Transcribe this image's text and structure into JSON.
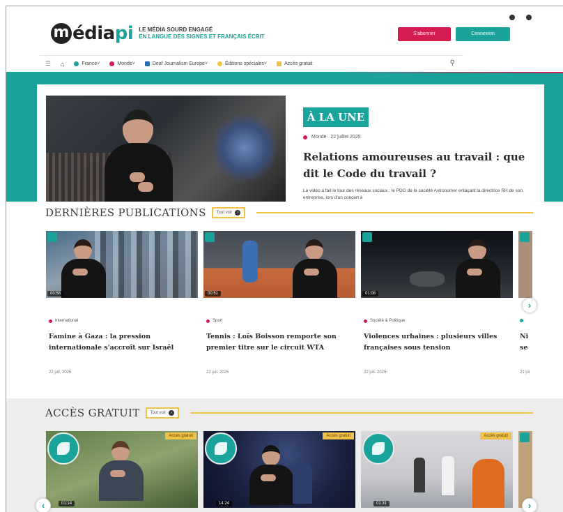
{
  "header": {
    "logo_m": "m",
    "logo_word": "édia",
    "logo_pi": "pi",
    "tagline_1": "Le média sourd engagé",
    "tagline_2": "En langue des signes et français écrit",
    "subscribe_label": "S'abonner",
    "login_label": "Connexion"
  },
  "nav": {
    "items": [
      {
        "label": "France",
        "color": "#1aa39a"
      },
      {
        "label": "Monde",
        "color": "#d51c52"
      },
      {
        "label": "Deaf Journalism Europe",
        "color": "#2a6fb5"
      },
      {
        "label": "Éditions spéciales",
        "color": "#f0c24a"
      },
      {
        "label": "Accès gratuit",
        "color": "#f0c24a"
      }
    ]
  },
  "hero": {
    "badge": "À LA UNE",
    "category": "Monde",
    "date": "22 juillet 2025",
    "title": "Relations amoureuses au travail : que dit le Code du travail ?",
    "excerpt": "La vidéo a fait le tour des réseaux sociaux : le PDG de la société Astronomer enlaçant la directrice RH de son entreprise, lors d'un concert à"
  },
  "latest": {
    "title": "DERNIÈRES PUBLICATIONS",
    "see_all": "Tout voir",
    "cards": [
      {
        "duration": "00:58",
        "category": "International",
        "cat_color": "#d51c52",
        "title": "Famine à Gaza : la pression internationale s'accroît sur Israël",
        "date": "22 juil. 2025"
      },
      {
        "duration": "00:51",
        "category": "Sport",
        "cat_color": "#d51c52",
        "title": "Tennis : Loïs Boisson remporte son premier titre sur le circuit WTA",
        "date": "22 juil. 2025"
      },
      {
        "duration": "01:08",
        "category": "Société & Politique",
        "cat_color": "#d51c52",
        "title": "Violences urbaines : plusieurs villes françaises sous tension",
        "date": "22 juil. 2025"
      }
    ],
    "peek": {
      "category": "",
      "title": "Ni se",
      "date": "21 jui"
    }
  },
  "free": {
    "title": "ACCÈS GRATUIT",
    "see_all": "Tout voir",
    "tag": "Accès gratuit",
    "cards": [
      {
        "duration": "01:14"
      },
      {
        "duration": "14:24"
      },
      {
        "duration": "01:31"
      }
    ]
  },
  "colors": {
    "teal": "#1aa39a",
    "red": "#d51c52",
    "yellow": "#f0c24a"
  }
}
